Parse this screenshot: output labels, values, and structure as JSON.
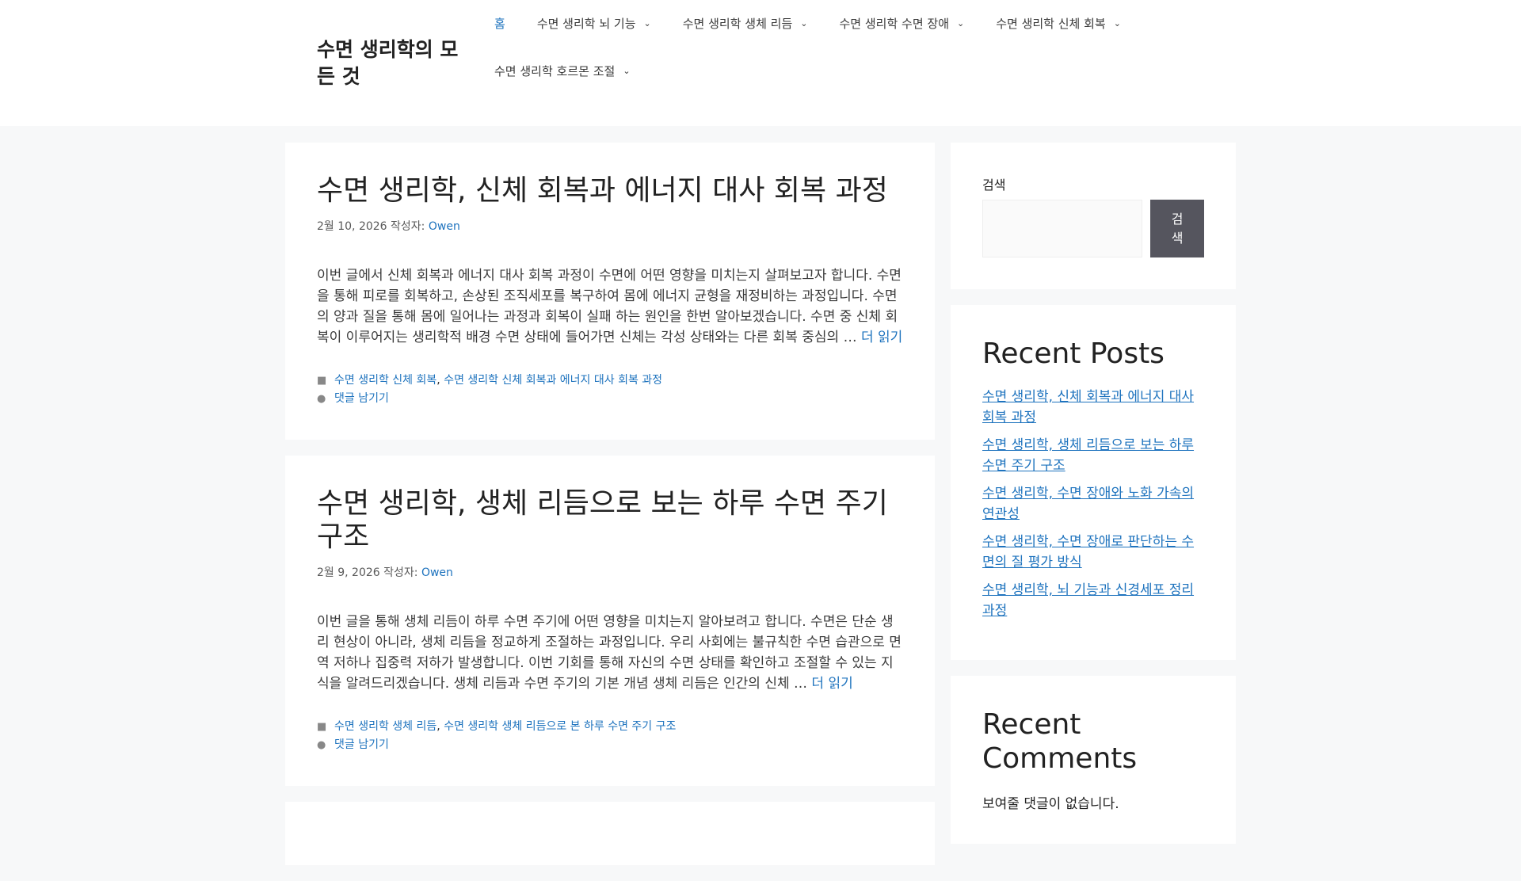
{
  "site": {
    "title": "수면 생리학의 모든 것"
  },
  "nav": [
    {
      "label": "홈",
      "active": true
    },
    {
      "label": "수면 생리학 뇌 기능"
    },
    {
      "label": "수면 생리학 생체 리듬"
    },
    {
      "label": "수면 생리학 수면 장애"
    },
    {
      "label": "수면 생리학 신체 회복"
    },
    {
      "label": "수면 생리학 호르몬 조절"
    }
  ],
  "posts": [
    {
      "title": "수면 생리학, 신체 회복과 에너지 대사 회복 과정",
      "date": "2월 10, 2026",
      "by": "작성자:",
      "author": "Owen",
      "excerpt": "이번 글에서 신체 회복과 에너지 대사 회복 과정이 수면에 어떤 영향을 미치는지 살펴보고자 합니다. 수면을 통해 피로를 회복하고, 손상된 조직세포를 복구하여 몸에 에너지 균형을 재정비하는 과정입니다. 수면의 양과 질을 통해 몸에 일어나는 과정과 회복이 실패 하는 원인을 한번 알아보겠습니다. 수면 중 신체 회복이 이루어지는 생리학적 배경 수면 상태에 들어가면 신체는 각성 상태와는 다른 회복 중심의 …",
      "more": "더 읽기",
      "cat1": "수면 생리학 신체 회복",
      "cat2": "수면 생리학 신체 회복과 에너지 대사 회복 과정",
      "comment": "댓글 남기기"
    },
    {
      "title": "수면 생리학, 생체 리듬으로 보는 하루 수면 주기 구조",
      "date": "2월 9, 2026",
      "by": "작성자:",
      "author": "Owen",
      "excerpt": "이번 글을 통해 생체 리듬이 하루 수면 주기에 어떤 영향을 미치는지 알아보려고 합니다. 수면은 단순 생리 현상이 아니라, 생체 리듬을 정교하게 조절하는 과정입니다. 우리 사회에는 불규칙한 수면 습관으로 면역 저하나 집중력 저하가 발생합니다. 이번 기회를 통해 자신의 수면 상태를 확인하고 조절할 수 있는 지식을 알려드리겠습니다. 생체 리듬과 수면 주기의 기본 개념 생체 리듬은 인간의 신체 …",
      "more": "더 읽기",
      "cat1": "수면 생리학 생체 리듬",
      "cat2": "수면 생리학 생체 리듬으로 본 하루 수면 주기 구조",
      "comment": "댓글 남기기"
    }
  ],
  "sidebar": {
    "search_label": "검색",
    "search_button": "검색",
    "recent_posts_title": "Recent Posts",
    "recent_posts": [
      "수면 생리학, 신체 회복과 에너지 대사 회복 과정",
      "수면 생리학, 생체 리듬으로 보는 하루 수면 주기 구조",
      "수면 생리학, 수면 장애와 노화 가속의 연관성",
      "수면 생리학, 수면 장애로 판단하는 수면의 질 평가 방식",
      "수면 생리학, 뇌 기능과 신경세포 정리 과정"
    ],
    "recent_comments_title": "Recent Comments",
    "no_comments": "보여줄 댓글이 없습니다."
  }
}
